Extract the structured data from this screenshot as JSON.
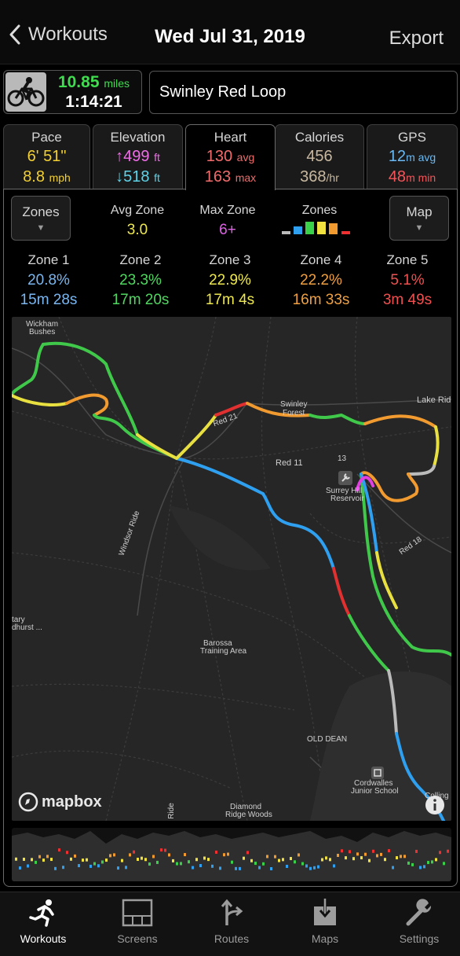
{
  "header": {
    "back_label": "Workouts",
    "title": "Wed Jul 31, 2019",
    "export_label": "Export"
  },
  "summary": {
    "activity_icon": "cycling-icon",
    "distance": "10.85",
    "distance_unit": "miles",
    "duration": "1:14:21",
    "workout_name": "Swinley Red Loop"
  },
  "tabs": [
    {
      "label": "Pace",
      "v1": "6' 51\"",
      "v1_unit": "",
      "v2": "8.8",
      "v2_unit": "mph",
      "v1_color": "#f2d033",
      "v2_color": "#f2d033"
    },
    {
      "label": "Elevation",
      "v1": "↑499",
      "v1_unit": "ft",
      "v2": "↓518",
      "v2_unit": "ft",
      "v1_color": "#f06ee8",
      "v2_color": "#5fd3e8"
    },
    {
      "label": "Heart",
      "v1": "130",
      "v1_unit": "avg",
      "v2": "163",
      "v2_unit": "max",
      "v1_color": "#f06c6c",
      "v2_color": "#f06c6c"
    },
    {
      "label": "Calories",
      "v1": "456",
      "v1_unit": "",
      "v2": "368",
      "v2_unit": "/hr",
      "v1_color": "#c8b8a0",
      "v2_color": "#c8b8a0"
    },
    {
      "label": "GPS",
      "v1": "12",
      "v1_unit": "m avg",
      "v2": "48",
      "v2_unit": "m min",
      "v1_color": "#6ab8f2",
      "v2_color": "#f2565a"
    }
  ],
  "active_tab": "Heart",
  "heart": {
    "zones_button": "Zones",
    "map_button": "Map",
    "avg_zone_label": "Avg Zone",
    "avg_zone_value": "3.0",
    "max_zone_label": "Max Zone",
    "max_zone_value": "6+",
    "zones_legend_label": "Zones",
    "zones": [
      {
        "label": "Zone 1",
        "pct": "20.8%",
        "time": "15m 28s",
        "pct_color": "#7ab6f0",
        "time_color": "#7ab6f0"
      },
      {
        "label": "Zone 2",
        "pct": "23.3%",
        "time": "17m 20s",
        "pct_color": "#4fd860",
        "time_color": "#4fd860"
      },
      {
        "label": "Zone 3",
        "pct": "22.9%",
        "time": "17m 4s",
        "pct_color": "#eee850",
        "time_color": "#eee850"
      },
      {
        "label": "Zone 4",
        "pct": "22.2%",
        "time": "16m 33s",
        "pct_color": "#f0a040",
        "time_color": "#f0a040"
      },
      {
        "label": "Zone 5",
        "pct": "5.1%",
        "time": "3m 49s",
        "pct_color": "#f05050",
        "time_color": "#f05050"
      }
    ]
  },
  "map": {
    "attribution": "mapbox",
    "labels": [
      "Wickham",
      "Bushes",
      "Swinley",
      "Forest",
      "Lake Rid",
      "Red 21",
      "Red 11",
      "13",
      "Surrey Hill",
      "Reservoir",
      "Red 18",
      "Windsor Ride",
      "Barossa",
      "Training Area",
      "OLD DEAN",
      "Cordwalles",
      "Junior School",
      "Diamond",
      "Ridge Woods",
      "Ride",
      "tary",
      "dhurst ...",
      "Colling"
    ]
  },
  "tabbar": [
    {
      "label": "Workouts",
      "icon": "runner-icon",
      "active": true
    },
    {
      "label": "Screens",
      "icon": "screens-icon",
      "active": false
    },
    {
      "label": "Routes",
      "icon": "routes-icon",
      "active": false
    },
    {
      "label": "Maps",
      "icon": "maps-download-icon",
      "active": false
    },
    {
      "label": "Settings",
      "icon": "wrench-icon",
      "active": false
    }
  ]
}
